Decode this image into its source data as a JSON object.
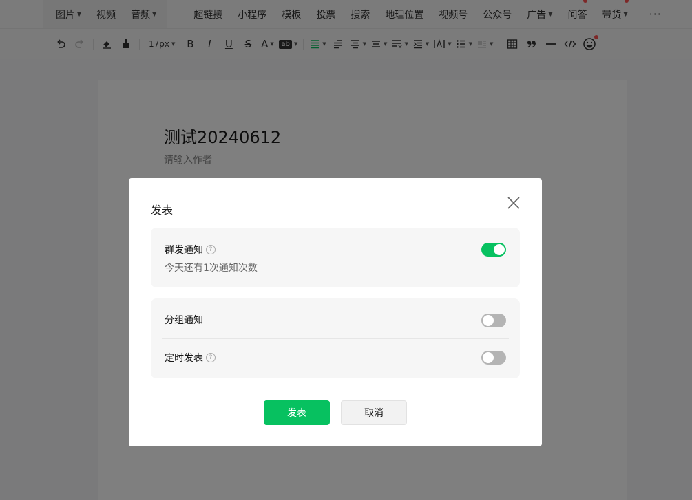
{
  "menu": {
    "group1": [
      {
        "label": "图片",
        "caret": true
      },
      {
        "label": "视频",
        "caret": false
      },
      {
        "label": "音频",
        "caret": true
      }
    ],
    "group2": [
      {
        "label": "超链接",
        "caret": false,
        "dot": false
      },
      {
        "label": "小程序",
        "caret": false,
        "dot": false
      },
      {
        "label": "模板",
        "caret": false,
        "dot": false
      },
      {
        "label": "投票",
        "caret": false,
        "dot": false
      },
      {
        "label": "搜索",
        "caret": false,
        "dot": false
      },
      {
        "label": "地理位置",
        "caret": false,
        "dot": false
      },
      {
        "label": "视频号",
        "caret": false,
        "dot": false
      },
      {
        "label": "公众号",
        "caret": false,
        "dot": false
      },
      {
        "label": "广告",
        "caret": true,
        "dot": false
      },
      {
        "label": "问答",
        "caret": false,
        "dot": true
      },
      {
        "label": "带货",
        "caret": true,
        "dot": true
      }
    ],
    "more": "···"
  },
  "toolbar": {
    "font_size": "17px",
    "bold": "B",
    "italic": "I",
    "underline": "U",
    "strike": "S",
    "font_color": "A",
    "highlight": "ab"
  },
  "editor": {
    "title": "测试20240612",
    "author_placeholder": "请输入作者"
  },
  "dialog": {
    "title": "发表",
    "mass_notify": {
      "label": "群发通知",
      "sub": "今天还有1次通知次数",
      "on": true
    },
    "group_notify": {
      "label": "分组通知",
      "on": false
    },
    "scheduled": {
      "label": "定时发表",
      "on": false
    },
    "confirm": "发表",
    "cancel": "取消"
  },
  "colors": {
    "accent": "#07c160",
    "badge": "#fa5151",
    "switch_off": "#b4b4b4"
  }
}
